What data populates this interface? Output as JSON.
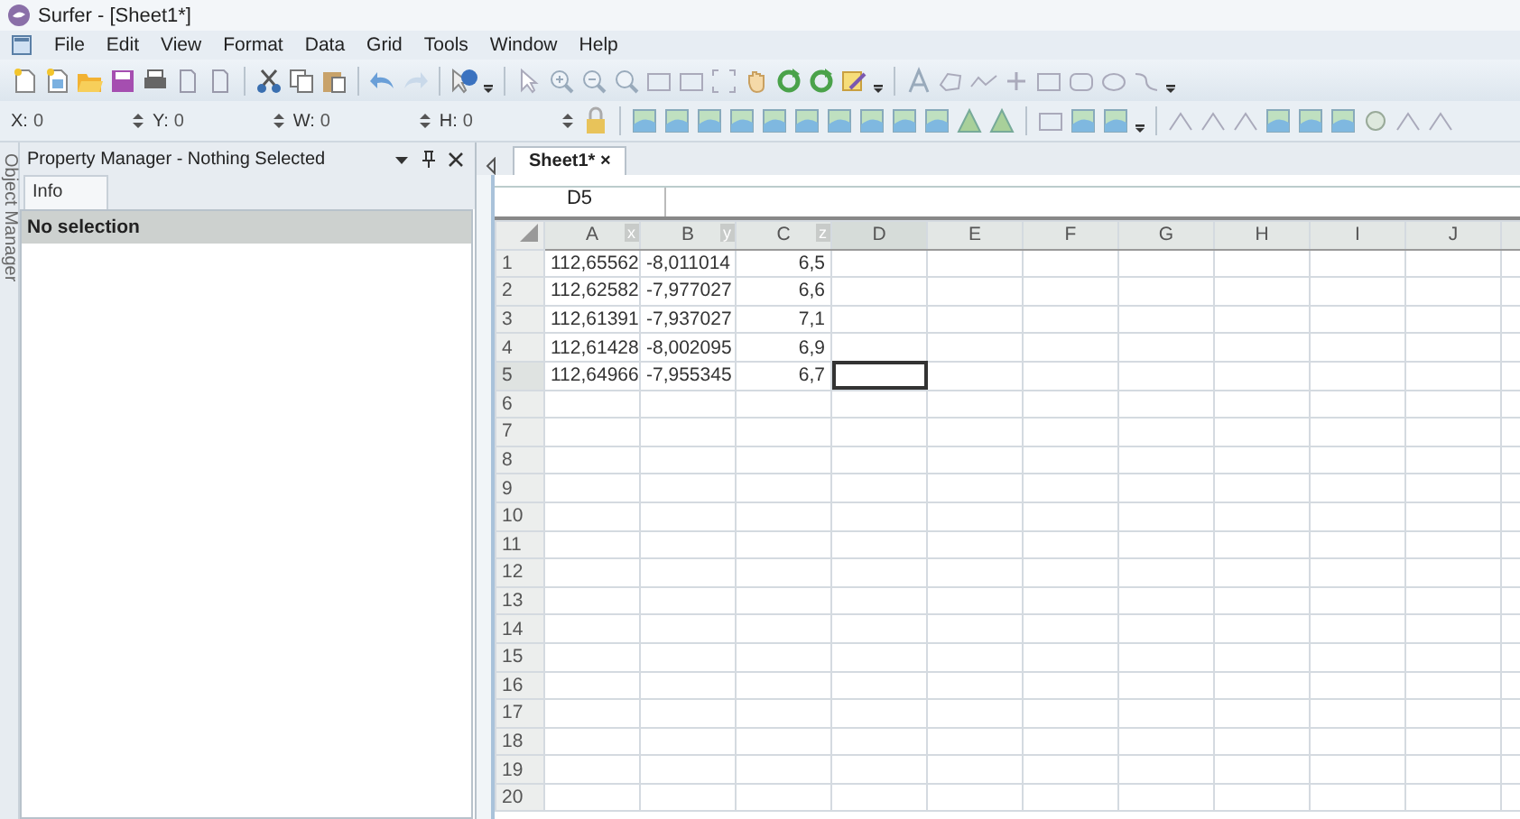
{
  "window": {
    "title": "Surfer - [Sheet1*]"
  },
  "menu": [
    "File",
    "Edit",
    "View",
    "Format",
    "Data",
    "Grid",
    "Tools",
    "Window",
    "Help"
  ],
  "coordinates": [
    {
      "label": "X:",
      "value": "0"
    },
    {
      "label": "Y:",
      "value": "0"
    },
    {
      "label": "W:",
      "value": "0"
    },
    {
      "label": "H:",
      "value": "0"
    }
  ],
  "side_tab": "Object Manager",
  "property_manager": {
    "title": "Property Manager - Nothing Selected",
    "tabs": [
      {
        "label": "Info",
        "selected": true
      }
    ],
    "header": "No selection"
  },
  "document_tabs": [
    {
      "label": "Sheet1*",
      "selected": true,
      "close": "×"
    }
  ],
  "sheet": {
    "name_box": "D5",
    "columns": [
      {
        "label": "A",
        "tag": "x",
        "selected": false
      },
      {
        "label": "B",
        "tag": "y",
        "selected": false
      },
      {
        "label": "C",
        "tag": "z",
        "selected": false
      },
      {
        "label": "D",
        "selected": true
      },
      {
        "label": "E",
        "selected": false
      },
      {
        "label": "F",
        "selected": false
      },
      {
        "label": "G",
        "selected": false
      },
      {
        "label": "H",
        "selected": false
      },
      {
        "label": "I",
        "selected": false
      },
      {
        "label": "J",
        "selected": false
      }
    ],
    "rows": [
      {
        "label": "1",
        "selected": false,
        "cells": [
          "112,65562",
          "-8,011014",
          "6,5"
        ]
      },
      {
        "label": "2",
        "selected": false,
        "cells": [
          "112,62582",
          "-7,977027",
          "6,6"
        ]
      },
      {
        "label": "3",
        "selected": false,
        "cells": [
          "112,61391",
          "-7,937027",
          "7,1"
        ]
      },
      {
        "label": "4",
        "selected": false,
        "cells": [
          "112,61428",
          "-8,002095",
          "6,9"
        ]
      },
      {
        "label": "5",
        "selected": true,
        "cells": [
          "112,64966",
          "-7,955345",
          "6,7"
        ]
      },
      {
        "label": "6",
        "selected": false,
        "cells": []
      },
      {
        "label": "7",
        "selected": false,
        "cells": []
      },
      {
        "label": "8",
        "selected": false,
        "cells": []
      },
      {
        "label": "9",
        "selected": false,
        "cells": []
      },
      {
        "label": "10",
        "selected": false,
        "cells": []
      },
      {
        "label": "11",
        "selected": false,
        "cells": []
      },
      {
        "label": "12",
        "selected": false,
        "cells": []
      },
      {
        "label": "13",
        "selected": false,
        "cells": []
      },
      {
        "label": "14",
        "selected": false,
        "cells": []
      },
      {
        "label": "15",
        "selected": false,
        "cells": []
      },
      {
        "label": "16",
        "selected": false,
        "cells": []
      },
      {
        "label": "17",
        "selected": false,
        "cells": []
      },
      {
        "label": "18",
        "selected": false,
        "cells": []
      },
      {
        "label": "19",
        "selected": false,
        "cells": []
      },
      {
        "label": "20",
        "selected": false,
        "cells": []
      }
    ]
  }
}
